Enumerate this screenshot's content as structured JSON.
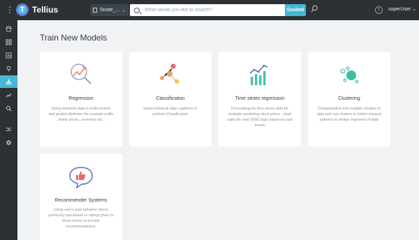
{
  "app": {
    "name": "Tellius"
  },
  "header": {
    "dataset_label": "Strate_...",
    "search_placeholder": "What would you like to search?",
    "guided_label": "Guided",
    "info_symbol": "!",
    "user_label": "superUser"
  },
  "sidebar": {
    "items": [
      {
        "name": "data"
      },
      {
        "name": "explore"
      },
      {
        "name": "vizpad"
      },
      {
        "name": "insights"
      },
      {
        "name": "predict",
        "active": true
      },
      {
        "name": "trends"
      },
      {
        "name": "search"
      },
      {
        "name": "flows"
      },
      {
        "name": "settings"
      }
    ]
  },
  "main": {
    "title": "Train New Models",
    "cards": [
      {
        "title": "Regression",
        "description": "Using historical data to build models and predict attributes for example traffic , home prices , inventory etc..."
      },
      {
        "title": "Classification",
        "description": "Using historical data / patterns to perform Classification"
      },
      {
        "title": "Time series regression",
        "description": "Forecasting for time series data for example predicting stock prices , retail sales for next 30/60 days based on past trends"
      },
      {
        "title": "Clustering",
        "description": "Categorization into multiple clusters of data and use clusters to detect unusual patterns or similar segments of data"
      },
      {
        "title": "Recommender Systems",
        "description": "Using user's past behavior (items previously purchased or ratings given to those items) to provide recommendations."
      }
    ]
  },
  "colors": {
    "accent": "#46b8d3",
    "topbar": "#2c3136",
    "background": "#f1f2f4"
  }
}
